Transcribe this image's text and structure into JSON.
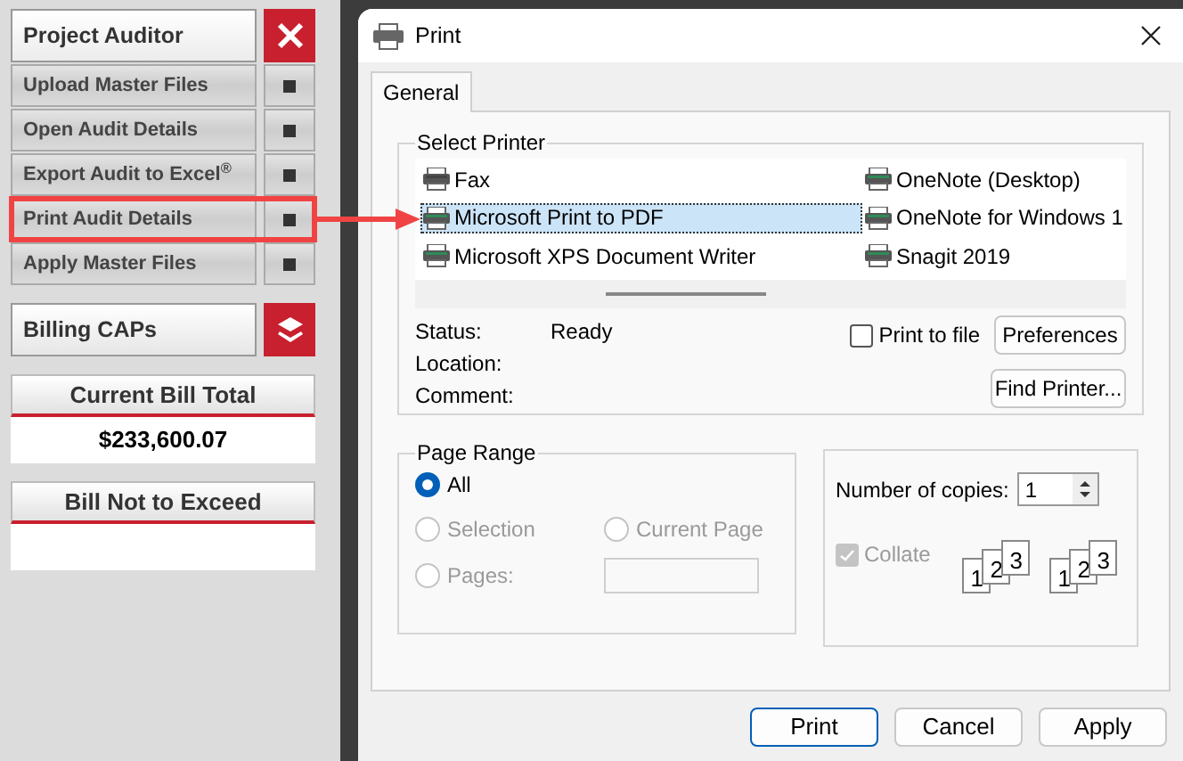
{
  "sidebar": {
    "title": "Project Auditor",
    "items": [
      {
        "label": "Upload Master Files",
        "annotated": false
      },
      {
        "label": "Open Audit Details",
        "annotated": false
      },
      {
        "label": "Export Audit to Excel$^{®}$",
        "annotated": false
      },
      {
        "label": "Print Audit Details",
        "annotated": true
      },
      {
        "label": "Apply Master Files",
        "annotated": false
      }
    ],
    "section": "Billing CAPs",
    "totals": [
      {
        "heading": "Current Bill Total",
        "value": "$233,600.07"
      },
      {
        "heading": "Bill Not to Exceed"
      }
    ]
  },
  "dialog": {
    "title": "Print",
    "tabs": [
      {
        "label": "General",
        "selected": true
      }
    ],
    "select_printer": {
      "legend": "Select Printer",
      "printers": [
        {
          "name": "Fax",
          "selected": false,
          "kind": "fax"
        },
        {
          "name": "Microsoft Print to PDF",
          "selected": true,
          "kind": "printer"
        },
        {
          "name": "Microsoft XPS Document Writer",
          "selected": false,
          "kind": "printer"
        },
        {
          "name": "OneNote (Desktop)",
          "selected": false,
          "kind": "printer"
        },
        {
          "name": "OneNote for Windows 1",
          "selected": false,
          "kind": "printer"
        },
        {
          "name": "Snagit 2019",
          "selected": false,
          "kind": "printer"
        }
      ],
      "status_label": "Status:",
      "status": "Ready",
      "location_label": "Location:",
      "comment_label": "Comment:",
      "print_to_file": {
        "label": "Print to file",
        "checked": false
      },
      "buttons": [
        "Preferences",
        "Find Printer..."
      ]
    },
    "page_range": {
      "legend": "Page Range",
      "options": [
        {
          "label": "All",
          "selected": true,
          "disabled": false
        },
        {
          "label": "Selection",
          "selected": false,
          "disabled": true
        },
        {
          "label": "Current Page",
          "selected": false,
          "disabled": true
        },
        {
          "label": "Pages:",
          "selected": false,
          "disabled": true
        }
      ]
    },
    "copies": {
      "label": "Number of copies:",
      "value": "1",
      "collate": {
        "label": "Collate",
        "checked": true,
        "disabled": true
      },
      "collate_groups": [
        [
          "1",
          "2",
          "3"
        ],
        [
          "1",
          "2",
          "3"
        ]
      ]
    },
    "buttons": [
      {
        "label": "Print",
        "default": true
      },
      {
        "label": "Cancel",
        "default": false
      },
      {
        "label": "Apply",
        "default": false
      }
    ]
  }
}
